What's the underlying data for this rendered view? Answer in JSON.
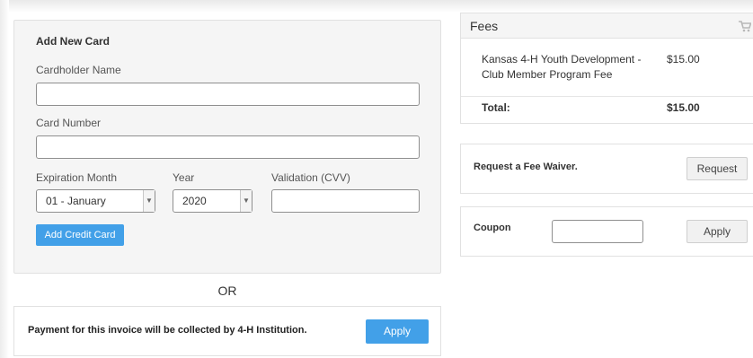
{
  "add_card": {
    "title": "Add New Card",
    "cardholder_label": "Cardholder Name",
    "cardholder_value": "",
    "card_number_label": "Card Number",
    "card_number_value": "",
    "exp_month_label": "Expiration Month",
    "exp_month_value": "01 - January",
    "year_label": "Year",
    "year_value": "2020",
    "cvv_label": "Validation (CVV)",
    "cvv_value": "",
    "add_button": "Add Credit Card"
  },
  "or_text": "OR",
  "invoice": {
    "text": "Payment for this invoice will be collected by 4-H Institution.",
    "apply_button": "Apply"
  },
  "fees": {
    "title": "Fees",
    "items": [
      {
        "name_line1": "Kansas 4-H Youth Development -",
        "name_line2": "Club Member Program Fee",
        "amount": "$15.00"
      }
    ],
    "total_label": "Total:",
    "total_amount": "$15.00"
  },
  "waiver": {
    "label": "Request a Fee Waiver.",
    "button": "Request"
  },
  "coupon": {
    "label": "Coupon",
    "value": "",
    "button": "Apply"
  },
  "colors": {
    "primary_button": "#42a0e8",
    "panel_bg": "#f5f5f5",
    "border": "#e1e1e1"
  },
  "icons": {
    "cart": "shopping-cart-icon",
    "select_arrow": "chevron-down-icon"
  }
}
